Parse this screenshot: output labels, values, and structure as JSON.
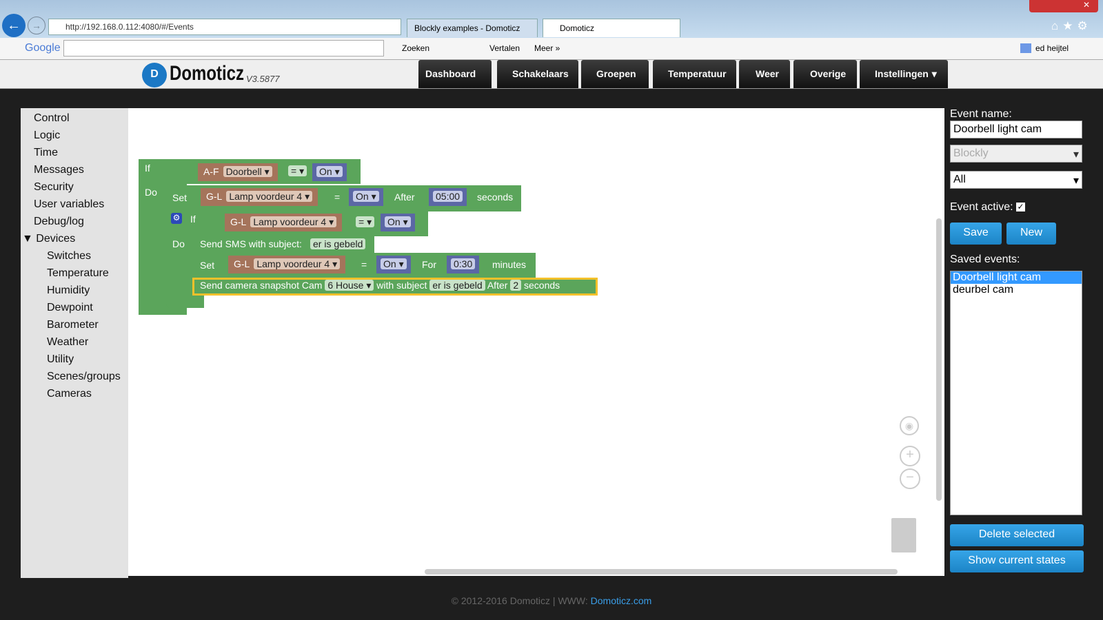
{
  "browser": {
    "url": "http://192.168.0.112:4080/#/Events",
    "tabs": [
      {
        "label": "Blockly examples - Domoticz"
      },
      {
        "label": "Domoticz"
      }
    ],
    "toolbar": {
      "google": "Google",
      "search": "Zoeken",
      "translate": "Vertalen",
      "more": "Meer »",
      "user": "ed heijtel"
    }
  },
  "header": {
    "logo": "Domoticz",
    "version": "V3.5877",
    "menu": [
      {
        "label": "Dashboard"
      },
      {
        "label": "Schakelaars"
      },
      {
        "label": "Groepen"
      },
      {
        "label": "Temperatuur"
      },
      {
        "label": "Weer"
      },
      {
        "label": "Overige"
      },
      {
        "label": "Instellingen"
      }
    ]
  },
  "sidebar": {
    "items": [
      "Control",
      "Logic",
      "Time",
      "Messages",
      "Security",
      "User variables",
      "Debug/log"
    ],
    "devices": "Devices",
    "sub": [
      "Switches",
      "Temperature",
      "Humidity",
      "Dewpoint",
      "Barometer",
      "Weather",
      "Utility",
      "Scenes/groups",
      "Cameras"
    ]
  },
  "blocks": {
    "if": "If",
    "do": "Do",
    "af": "A-F",
    "doorbell": "Doorbell ▾",
    "eq": "= ▾",
    "on": "On ▾",
    "set": "Set",
    "gl": "G-L",
    "lamp": "Lamp voordeur 4 ▾",
    "eqplain": "=",
    "after": "After",
    "t1": "05:00",
    "seconds": "seconds",
    "sms": "Send SMS with subject:",
    "subject": "er is gebeld",
    "for": "For",
    "t2": "0:30",
    "minutes": "minutes",
    "snap": "Send camera snapshot  Cam",
    "cam": "6 House ▾",
    "withsub": "with subject",
    "delay": "2"
  },
  "panel": {
    "event_name_label": "Event name:",
    "event_name": "Doorbell light cam",
    "type": "Blockly",
    "trigger": "All",
    "active_label": "Event active:",
    "active": true,
    "save": "Save",
    "new": "New",
    "saved_label": "Saved events:",
    "saved": [
      "Doorbell light cam",
      "deurbel cam"
    ],
    "delete": "Delete selected",
    "show": "Show current states"
  },
  "footer": {
    "text": "© 2012-2016 Domoticz | WWW: ",
    "link": "Domoticz.com"
  }
}
